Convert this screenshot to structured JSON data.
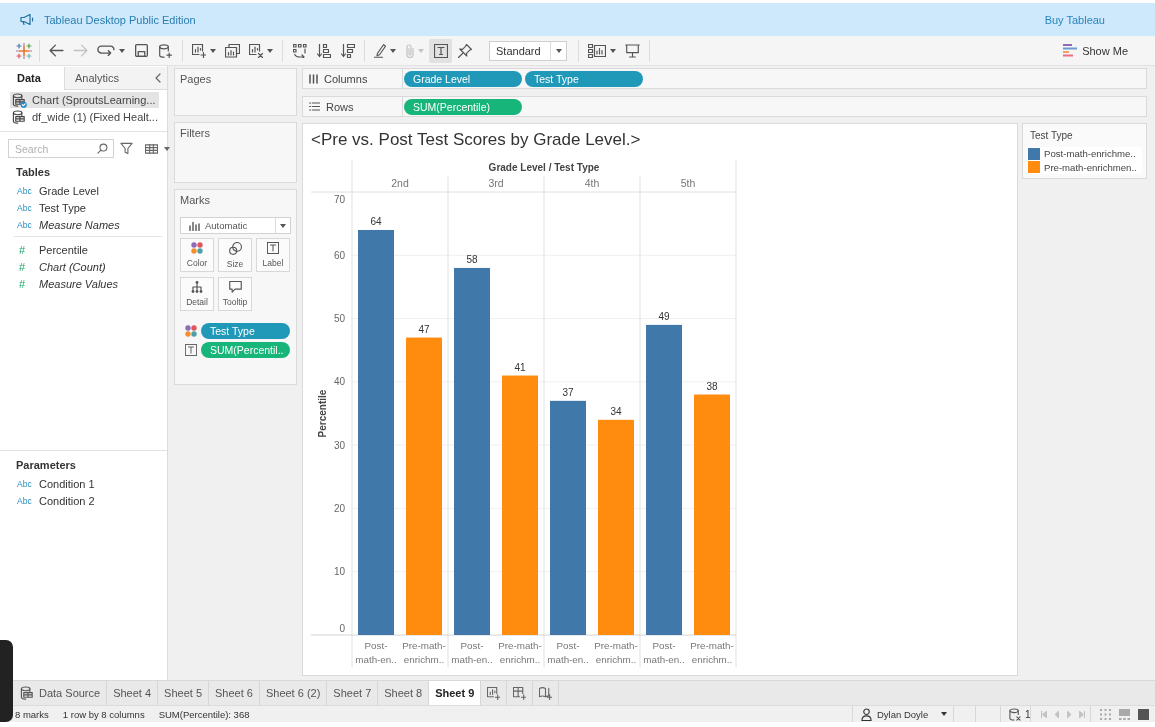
{
  "banner": {
    "title": "Tableau Desktop Public Edition",
    "link": "Buy Tableau"
  },
  "toolbar": {
    "groups": [
      [
        {
          "disabled": false,
          "on": false
        },
        {
          "disabled": true,
          "on": false
        },
        {
          "disabled": false,
          "on": false
        },
        {
          "disabled": false,
          "on": false
        },
        {
          "disabled": false,
          "on": false
        }
      ],
      [
        {
          "disabled": false,
          "on": false
        },
        {
          "disabled": false,
          "on": false
        },
        {
          "disabled": false,
          "on": false
        }
      ],
      [
        {
          "disabled": false,
          "on": false
        },
        {
          "disabled": false,
          "on": false
        },
        {
          "disabled": false,
          "on": false
        }
      ],
      [
        {
          "disabled": false,
          "on": false
        },
        {
          "disabled": true,
          "on": false
        },
        {
          "disabled": false,
          "on": true
        },
        {
          "disabled": false,
          "on": false
        }
      ],
      [
        {
          "disabled": false,
          "on": false
        },
        {
          "disabled": false,
          "on": false
        }
      ]
    ],
    "fit": "Standard",
    "show_me": "Show Me"
  },
  "data_pane": {
    "tabs": [
      {
        "label": "Data",
        "selected": true
      },
      {
        "label": "Analytics",
        "selected": false
      }
    ],
    "sources": [
      {
        "label": "Chart (SproutsLearning...",
        "selected": true
      },
      {
        "label": "df_wide (1) (Fixed Healt...",
        "selected": false
      }
    ],
    "search": {
      "placeholder": "Search"
    },
    "tables": {
      "heading": "Tables",
      "fields": [
        {
          "type_label": "Abc",
          "name": "Grade Level",
          "kind": "dimension",
          "generated": false
        },
        {
          "type_label": "Abc",
          "name": "Test Type",
          "kind": "dimension",
          "generated": false
        },
        {
          "type_label": "Abc",
          "name": "Measure Names",
          "kind": "dimension",
          "generated": true
        },
        {
          "type_label": "#",
          "name": "Percentile",
          "kind": "measure",
          "generated": false
        },
        {
          "type_label": "#",
          "name": "Chart (Count)",
          "kind": "measure",
          "generated": true
        },
        {
          "type_label": "#",
          "name": "Measure Values",
          "kind": "measure",
          "generated": true
        }
      ]
    },
    "parameters": {
      "heading": "Parameters",
      "fields": [
        {
          "type_label": "Abc",
          "name": "Condition 1",
          "kind": "dimension",
          "generated": false
        },
        {
          "type_label": "Abc",
          "name": "Condition 2",
          "kind": "dimension",
          "generated": false
        }
      ]
    }
  },
  "cards": [
    {
      "title": "Pages"
    },
    {
      "title": "Filters"
    }
  ],
  "marks_card": {
    "title": "Marks",
    "mark_type": "Automatic",
    "buttons": [
      {
        "kind": "color",
        "label": "Color"
      },
      {
        "kind": "size",
        "label": "Size"
      },
      {
        "kind": "label",
        "label": "Label"
      },
      {
        "kind": "detail",
        "label": "Detail"
      },
      {
        "kind": "tooltip",
        "label": "Tooltip"
      }
    ],
    "pills": [
      {
        "kind": "color",
        "label": "Test Type",
        "color": "#2098b7"
      },
      {
        "kind": "label",
        "label": "SUM(Percentil..",
        "color": "#17b57a"
      }
    ]
  },
  "shelves": [
    {
      "kind": "columns",
      "label": "Columns",
      "pills": [
        {
          "label": "Grade Level",
          "kind": "dimension"
        },
        {
          "label": "Test Type",
          "kind": "dimension"
        }
      ]
    },
    {
      "kind": "rows",
      "label": "Rows",
      "pills": [
        {
          "label": "SUM(Percentile)",
          "kind": "measure"
        }
      ]
    }
  ],
  "view": {
    "title": "<Pre vs. Post Test Scores by Grade Level.>",
    "chart_data": {
      "type": "bar",
      "xlabel": "Grade Level / Test Type",
      "ylabel": "Percentile",
      "categories": [
        "2nd",
        "3rd",
        "4th",
        "5th"
      ],
      "series": [
        {
          "name": "Post-math-en..",
          "color": "#4178aa",
          "values": [
            64,
            58,
            37,
            49
          ]
        },
        {
          "name": "Pre-math-enrichm..",
          "color": "#ff8b0f",
          "values": [
            47,
            41,
            34,
            38
          ]
        }
      ],
      "ylim": [
        0,
        70
      ],
      "yticks": [
        0,
        10,
        20,
        30,
        40,
        50,
        60,
        70
      ],
      "grid": true,
      "data_labels": true
    }
  },
  "legend": {
    "title": "Test Type",
    "items": [
      {
        "label": "Post-math-enrichme..",
        "color": "#4178aa"
      },
      {
        "label": "Pre-math-enrichmen..",
        "color": "#ff8b0f"
      }
    ]
  },
  "sheet_tabs": [
    {
      "kind": "data_source",
      "label": "Data Source",
      "selected": false
    },
    {
      "kind": "sheet",
      "label": "Sheet 4",
      "selected": false
    },
    {
      "kind": "sheet",
      "label": "Sheet 5",
      "selected": false
    },
    {
      "kind": "sheet",
      "label": "Sheet 6",
      "selected": false
    },
    {
      "kind": "sheet",
      "label": "Sheet 6 (2)",
      "selected": false
    },
    {
      "kind": "sheet",
      "label": "Sheet 7",
      "selected": false
    },
    {
      "kind": "sheet",
      "label": "Sheet 8",
      "selected": false
    },
    {
      "kind": "sheet",
      "label": "Sheet 9",
      "selected": true
    }
  ],
  "status": {
    "marks": "8 marks",
    "size": "1 row by 8 columns",
    "sum": "SUM(Percentile): 368",
    "user": "Dylan Doyle",
    "sources_count": "1",
    "view_modes": [
      {
        "selected": false
      },
      {
        "selected": false
      },
      {
        "selected": true
      }
    ]
  }
}
